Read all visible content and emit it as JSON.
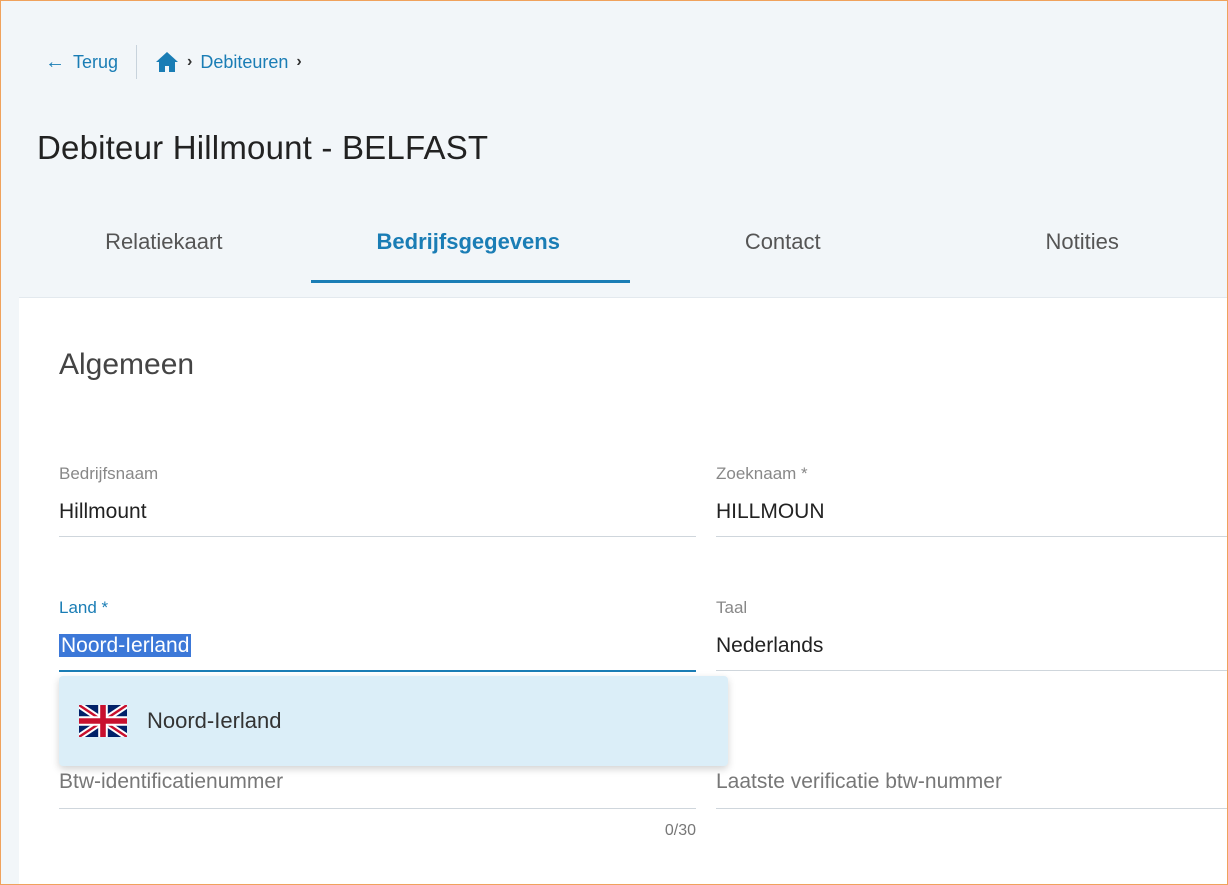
{
  "nav": {
    "back_label": "Terug",
    "breadcrumb": [
      "Debiteuren"
    ]
  },
  "page": {
    "title": "Debiteur Hillmount - BELFAST"
  },
  "tabs": [
    {
      "label": "Relatiekaart",
      "active": false
    },
    {
      "label": "Bedrijfsgegevens",
      "active": true
    },
    {
      "label": "Contact",
      "active": false
    },
    {
      "label": "Notities",
      "active": false
    }
  ],
  "section": {
    "title": "Algemeen"
  },
  "fields": {
    "bedrijfsnaam": {
      "label": "Bedrijfsnaam",
      "value": "Hillmount"
    },
    "zoeknaam": {
      "label": "Zoeknaam *",
      "value": "HILLMOUN"
    },
    "land": {
      "label": "Land *",
      "value": "Noord-Ierland"
    },
    "taal": {
      "label": "Taal",
      "value": "Nederlands"
    },
    "btw": {
      "placeholder": "Btw-identificatienummer",
      "counter": "0/30"
    },
    "verificatie": {
      "placeholder": "Laatste verificatie btw-nummer"
    }
  },
  "dropdown": {
    "options": [
      {
        "label": "Noord-Ierland",
        "icon": "uk-flag-icon"
      }
    ]
  },
  "colors": {
    "accent": "#1a7db5",
    "frame_border": "#f0a25c",
    "header_bg": "#f2f6f9",
    "dropdown_bg": "#dbeef8",
    "selection": "#3c78d8"
  }
}
